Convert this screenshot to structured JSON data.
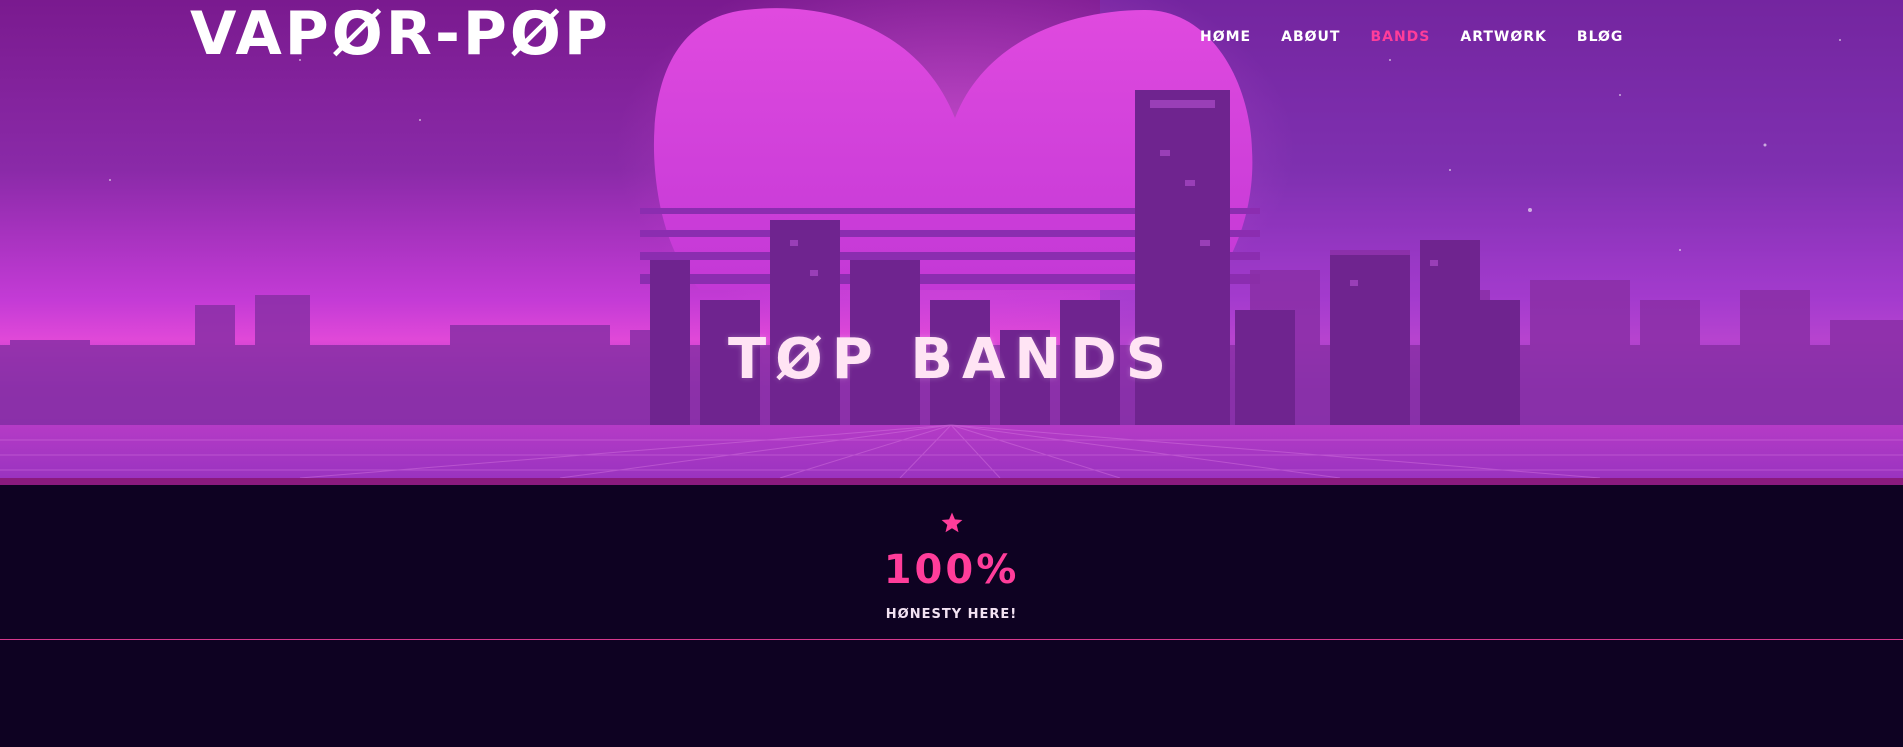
{
  "header": {
    "logo": "VAPØR-PØP"
  },
  "nav": {
    "items": [
      {
        "label": "HØME",
        "active": false
      },
      {
        "label": "ABØUT",
        "active": false
      },
      {
        "label": "BANDS",
        "active": true
      },
      {
        "label": "ARTWØRK",
        "active": false
      },
      {
        "label": "BLØG",
        "active": false
      }
    ]
  },
  "hero": {
    "title": "TØP BANDS"
  },
  "stat": {
    "icon": "star-icon",
    "value": "100%",
    "label": "HØNESTY HERE!"
  },
  "colors": {
    "accent": "#ff3d9a",
    "background": "#0e0222",
    "hero_magenta": "#e048d8",
    "hero_purple": "#7d2ab5"
  }
}
